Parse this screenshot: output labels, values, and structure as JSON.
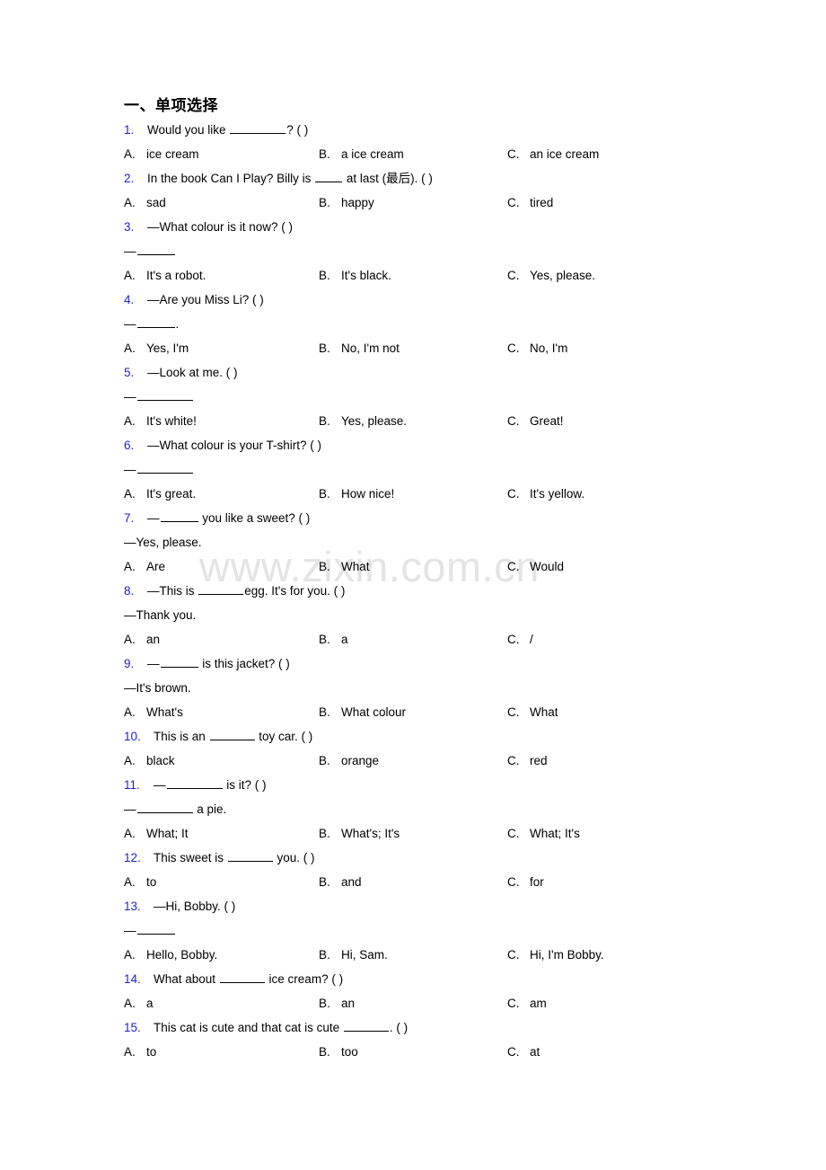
{
  "document": {
    "section_title": "一、单项选择",
    "watermark": "www.zixin.com.cn",
    "number_color": "#2323cc",
    "text_color": "#000000",
    "background": "#ffffff"
  },
  "questions": [
    {
      "num": "1.",
      "stem_before": "Would you like ",
      "stem_after": "? (   )",
      "blank": "b62",
      "continuation": "",
      "options": [
        {
          "label": "A.",
          "text": "ice cream"
        },
        {
          "label": "B.",
          "text": "a ice cream"
        },
        {
          "label": "C.",
          "text": "an ice cream"
        }
      ]
    },
    {
      "num": "2.",
      "stem_before": "In the book Can I Play? Billy is ",
      "stem_after": " at last (最后). (   )",
      "blank": "b30",
      "continuation": "",
      "options": [
        {
          "label": "A.",
          "text": "sad"
        },
        {
          "label": "B.",
          "text": "happy"
        },
        {
          "label": "C.",
          "text": "tired"
        }
      ]
    },
    {
      "num": "3.",
      "stem_before": "—What colour is it now? (   )",
      "stem_after": "",
      "blank": "",
      "continuation_before": "—",
      "continuation_blank": "b42",
      "continuation_after": "",
      "options": [
        {
          "label": "A.",
          "text": "It's a robot."
        },
        {
          "label": "B.",
          "text": "It's black."
        },
        {
          "label": "C.",
          "text": "Yes, please."
        }
      ]
    },
    {
      "num": "4.",
      "stem_before": "—Are you Miss Li? (   )",
      "stem_after": "",
      "blank": "",
      "continuation_before": "—",
      "continuation_blank": "b42",
      "continuation_after": ".",
      "options": [
        {
          "label": "A.",
          "text": "Yes, I'm"
        },
        {
          "label": "B.",
          "text": "No, I'm not"
        },
        {
          "label": "C.",
          "text": "No, I'm"
        }
      ]
    },
    {
      "num": "5.",
      "stem_before": "—Look at me. (  )",
      "stem_after": "",
      "blank": "",
      "continuation_before": "—",
      "continuation_blank": "b62",
      "continuation_after": "",
      "options": [
        {
          "label": "A.",
          "text": "It's white!"
        },
        {
          "label": "B.",
          "text": "Yes, please."
        },
        {
          "label": "C.",
          "text": "Great!"
        }
      ]
    },
    {
      "num": "6.",
      "stem_before": "—What colour is your T-shirt? (  )",
      "stem_after": "",
      "blank": "",
      "continuation_before": "—",
      "continuation_blank": "b62",
      "continuation_after": "",
      "options": [
        {
          "label": "A.",
          "text": "It's great."
        },
        {
          "label": "B.",
          "text": "How nice!"
        },
        {
          "label": "C.",
          "text": "It's yellow."
        }
      ]
    },
    {
      "num": "7.",
      "stem_before": "—",
      "stem_after": " you like a sweet? (   )",
      "blank": "b42",
      "continuation": "—Yes, please.",
      "options": [
        {
          "label": "A.",
          "text": "Are"
        },
        {
          "label": "B.",
          "text": "What"
        },
        {
          "label": "C.",
          "text": "Would"
        }
      ]
    },
    {
      "num": "8.",
      "stem_before": "—This is ",
      "stem_after": "egg. It's for you. (  )",
      "blank": "b50",
      "continuation": "—Thank you.",
      "options": [
        {
          "label": "A.",
          "text": "an"
        },
        {
          "label": "B.",
          "text": "a"
        },
        {
          "label": "C.",
          "text": "/"
        }
      ]
    },
    {
      "num": "9.",
      "stem_before": "—",
      "stem_after": " is this jacket? (   )",
      "blank": "b42",
      "continuation": "—It's brown.",
      "options": [
        {
          "label": "A.",
          "text": "What's"
        },
        {
          "label": "B.",
          "text": "What colour"
        },
        {
          "label": "C.",
          "text": "What"
        }
      ]
    },
    {
      "num": "10.",
      "stem_before": "This is an ",
      "stem_after": " toy car. (  )",
      "blank": "b50",
      "continuation": "",
      "options": [
        {
          "label": "A.",
          "text": "black"
        },
        {
          "label": "B.",
          "text": "orange"
        },
        {
          "label": "C.",
          "text": "red"
        }
      ]
    },
    {
      "num": "11.",
      "stem_before": "—",
      "stem_after": " is it? ( )",
      "blank": "b62",
      "continuation_before": "—",
      "continuation_blank": "b62",
      "continuation_after": " a pie.",
      "options": [
        {
          "label": "A.",
          "text": "What; It"
        },
        {
          "label": "B.",
          "text": "What's; It's"
        },
        {
          "label": "C.",
          "text": "What; It's"
        }
      ]
    },
    {
      "num": "12.",
      "stem_before": "This sweet is ",
      "stem_after": " you. (   )",
      "blank": "b50",
      "continuation": "",
      "options": [
        {
          "label": "A.",
          "text": "to"
        },
        {
          "label": "B.",
          "text": "and"
        },
        {
          "label": "C.",
          "text": "for"
        }
      ]
    },
    {
      "num": "13.",
      "stem_before": "—Hi, Bobby. (  )",
      "stem_after": "",
      "blank": "",
      "continuation_before": "—",
      "continuation_blank": "b42",
      "continuation_after": "",
      "options": [
        {
          "label": "A.",
          "text": "Hello, Bobby."
        },
        {
          "label": "B.",
          "text": "Hi, Sam."
        },
        {
          "label": "C.",
          "text": "Hi, I'm Bobby."
        }
      ]
    },
    {
      "num": "14.",
      "stem_before": "What about ",
      "stem_after": " ice cream? (  )",
      "blank": "b50",
      "continuation": "",
      "options": [
        {
          "label": "A.",
          "text": "a"
        },
        {
          "label": "B.",
          "text": "an"
        },
        {
          "label": "C.",
          "text": "am"
        }
      ]
    },
    {
      "num": "15.",
      "stem_before": "This cat is cute and that cat is cute ",
      "stem_after": ". (   )",
      "blank": "b50",
      "continuation": "",
      "options": [
        {
          "label": "A.",
          "text": "to"
        },
        {
          "label": "B.",
          "text": "too"
        },
        {
          "label": "C.",
          "text": "at"
        }
      ]
    }
  ]
}
